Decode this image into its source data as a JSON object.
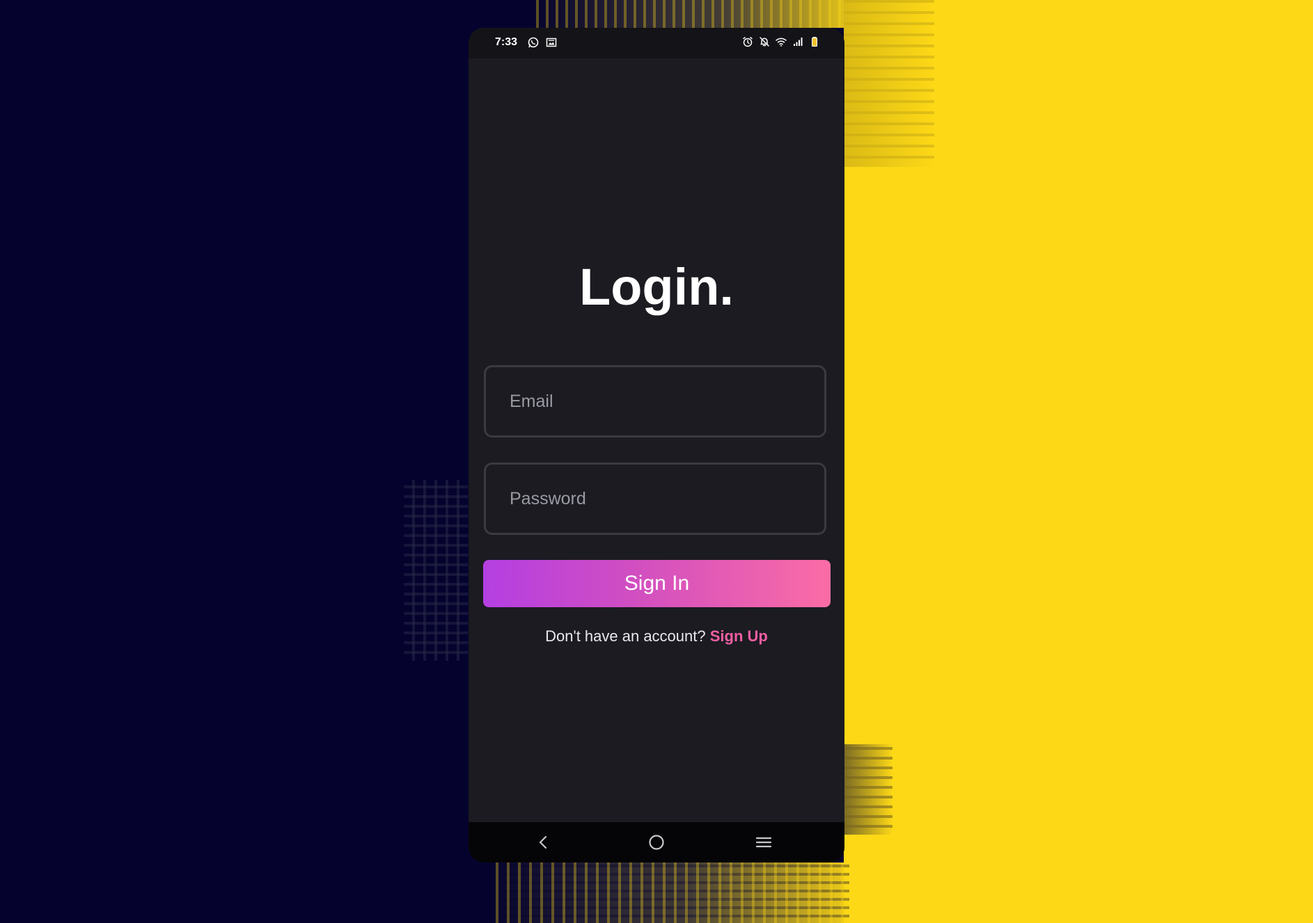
{
  "status_bar": {
    "time": "7:33",
    "left_icons": [
      "whatsapp-icon",
      "gallery-icon"
    ],
    "right_icons": [
      "alarm-icon",
      "notifications-off-icon",
      "wifi-icon",
      "signal-icon",
      "battery-icon"
    ],
    "battery_color": "#f2c230"
  },
  "login": {
    "title": "Login.",
    "email_placeholder": "Email",
    "password_placeholder": "Password",
    "signin_label": "Sign In",
    "no_account_text": "Don't have an account?",
    "signup_label": "Sign Up"
  },
  "nav_bar": {
    "buttons": [
      "back-icon",
      "home-icon",
      "recents-icon"
    ]
  },
  "colors": {
    "background_left": "#05032e",
    "background_right": "#fdd816",
    "screen_bg": "#1b1b21",
    "field_border": "#3a3a42",
    "button_gradient_start": "#b43fe2",
    "button_gradient_end": "#fb6ca5",
    "signup_link": "#f25ea3"
  }
}
